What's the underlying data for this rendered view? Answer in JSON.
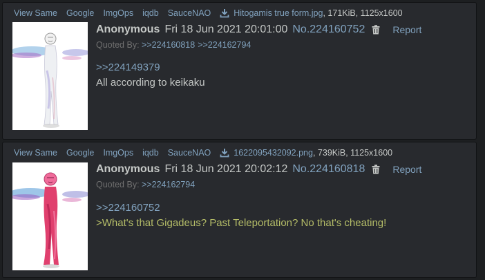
{
  "file_actions": [
    "View Same",
    "Google",
    "ImgOps",
    "iqdb",
    "SauceNAO"
  ],
  "posts": [
    {
      "file_name": "Hitogamis true form.jpg",
      "file_meta": ", 171KiB, 1125x1600",
      "name": "Anonymous",
      "date": "Fri 18 Jun 2021 20:01:00",
      "post_no": "No.224160752",
      "report_label": "Report",
      "quoted_by_label": "Quoted By:",
      "quoted_by": [
        ">>224160818",
        ">>224162794"
      ],
      "reply_to": ">>224149379",
      "text": "All according to keikaku"
    },
    {
      "file_name": "1622095432092.png",
      "file_meta": ", 739KiB, 1125x1600",
      "name": "Anonymous",
      "date": "Fri 18 Jun 2021 20:02:12",
      "post_no": "No.224160818",
      "report_label": "Report",
      "quoted_by_label": "Quoted By:",
      "quoted_by": [
        ">>224162794"
      ],
      "reply_to": ">>224160752",
      "greentext": ">What's that Gigadeus? Past Teleportation? No that's cheating!"
    }
  ],
  "colors": {
    "background": "#1d1f21",
    "post_bg": "#282a2e",
    "link": "#81a2be",
    "text": "#c5c8c6",
    "muted": "#707070",
    "greentext": "#b5bd68"
  },
  "icons": {
    "download": "download-icon",
    "delete": "trash-icon"
  }
}
